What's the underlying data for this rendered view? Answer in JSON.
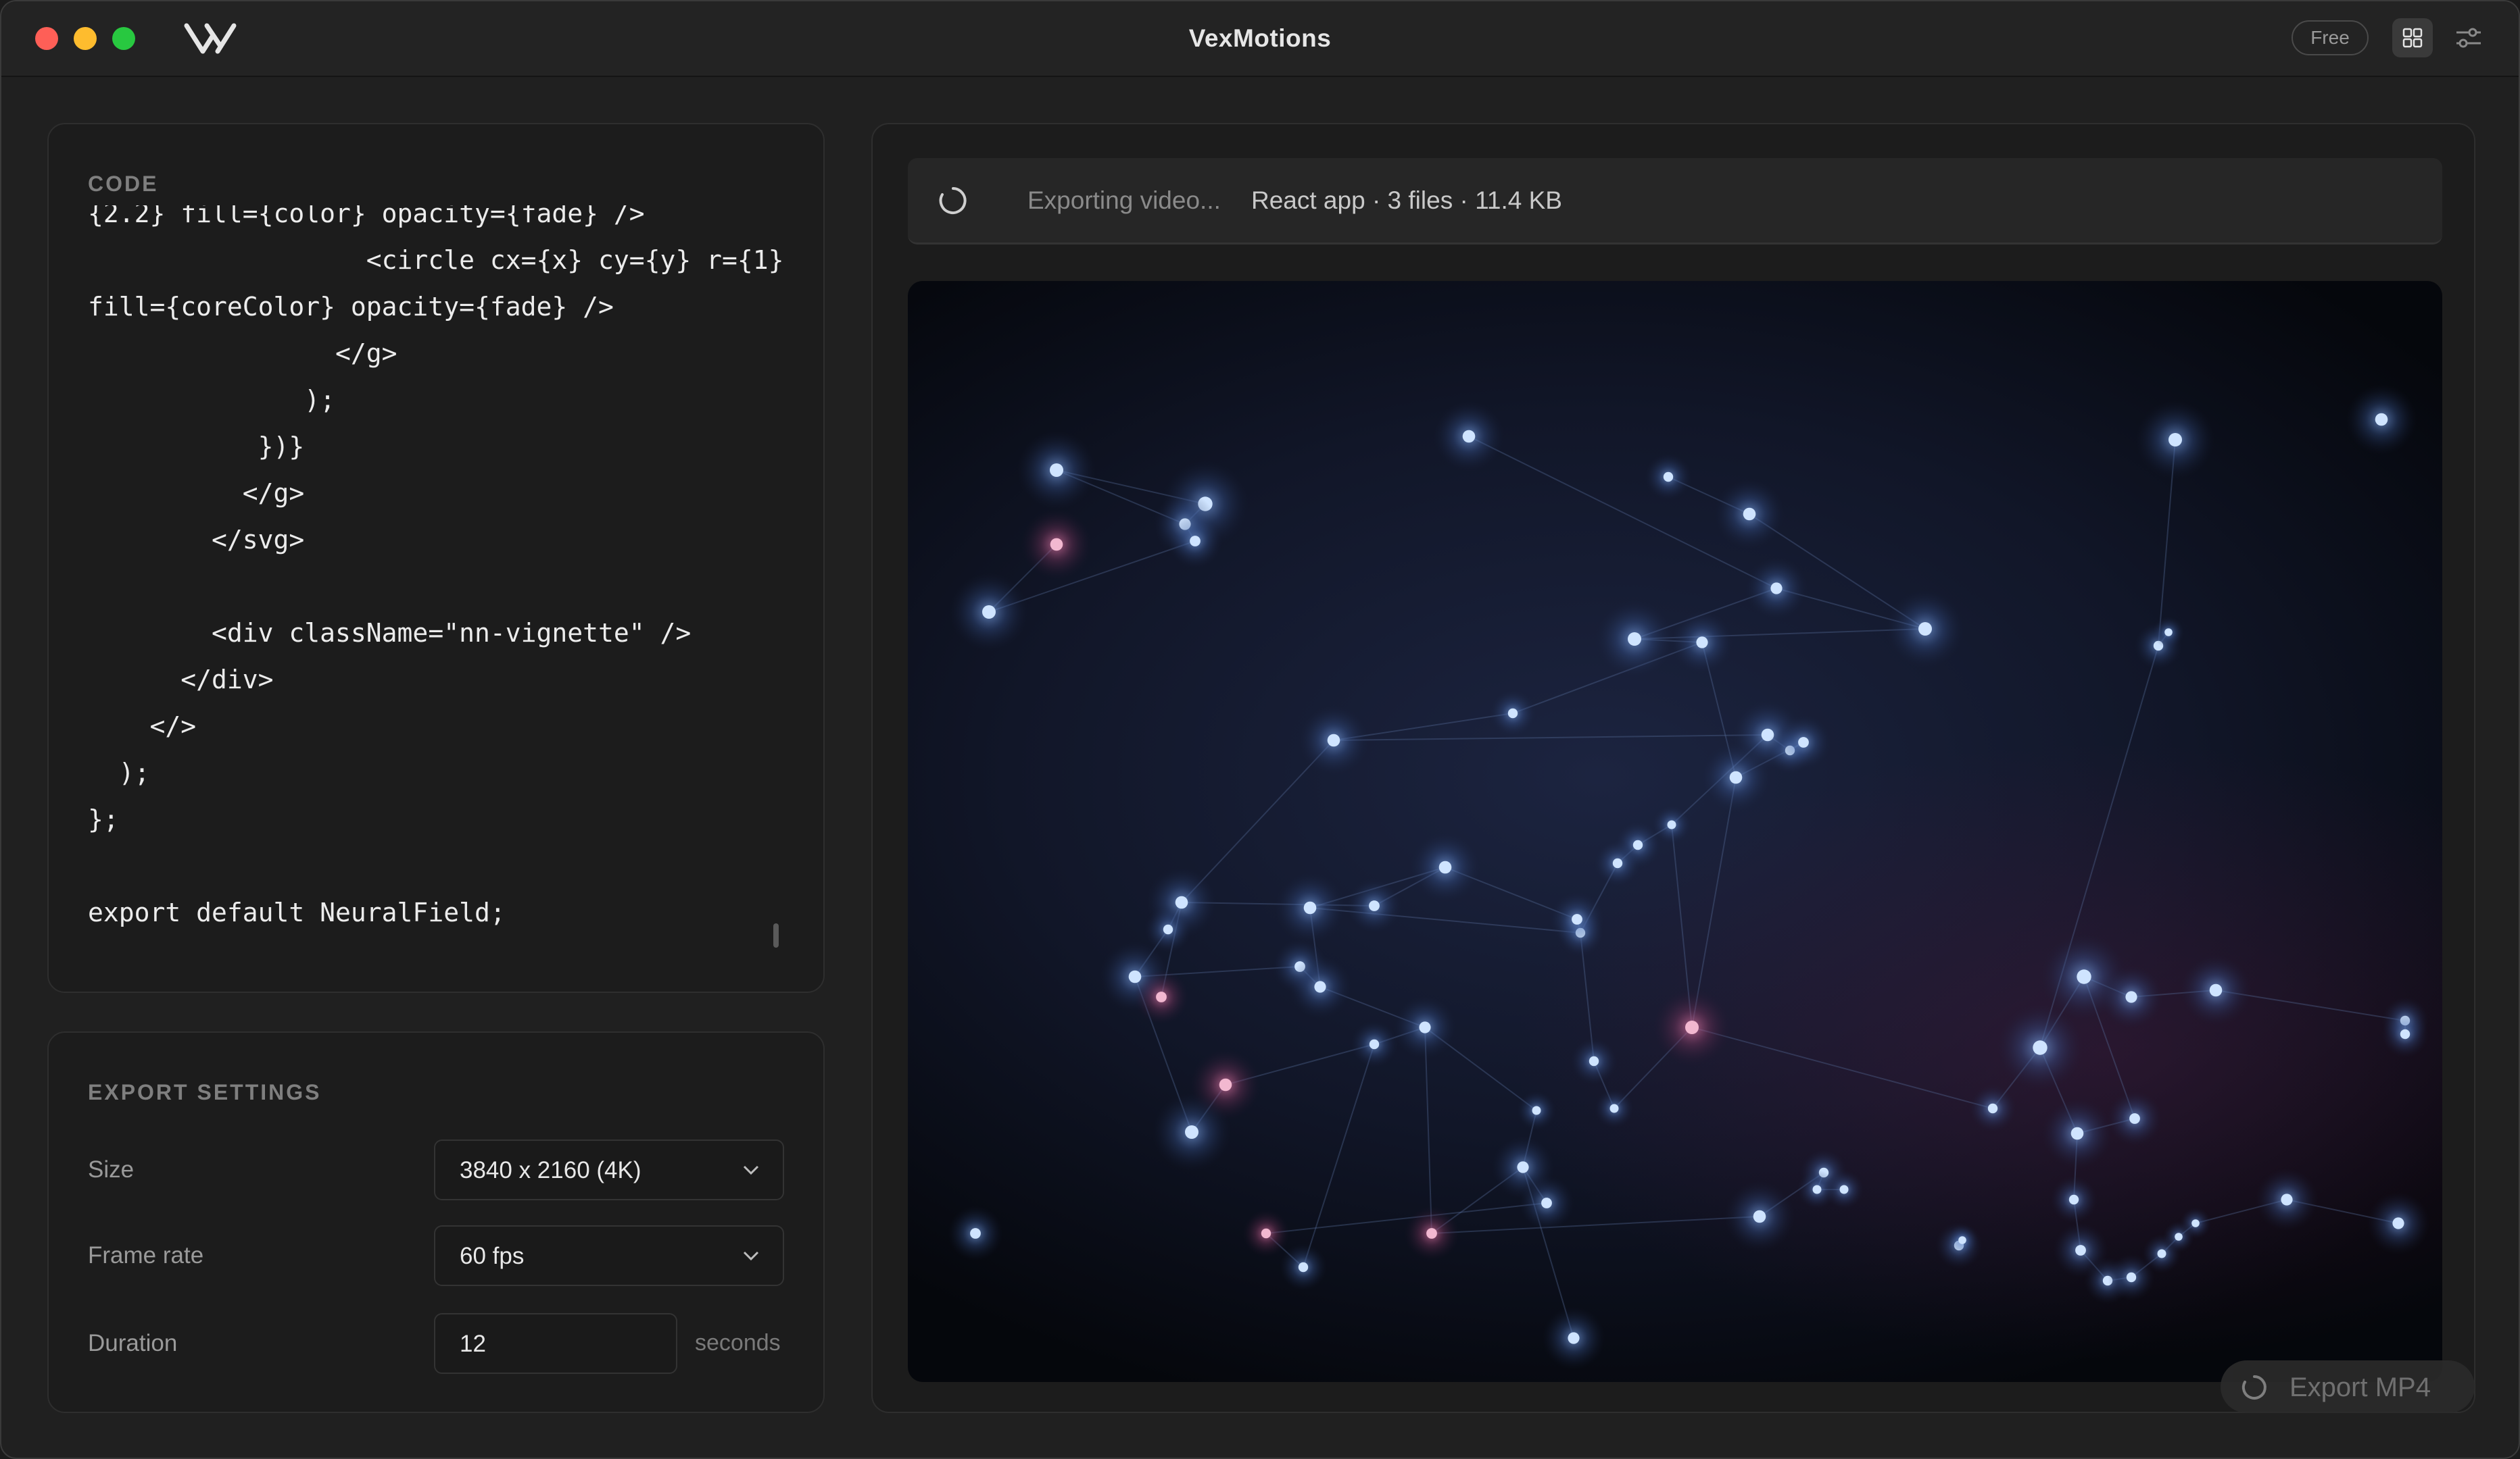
{
  "window": {
    "title": "VexMotions",
    "plan_badge": "Free"
  },
  "code_panel": {
    "label": "CODE",
    "lines": [
      "{2.2} fill={color} opacity={fade} />",
      "                  <circle cx={x} cy={y} r={1}",
      "fill={coreColor} opacity={fade} />",
      "                </g>",
      "              );",
      "           })}",
      "          </g>",
      "        </svg>",
      "",
      "        <div className=\"nn-vignette\" />",
      "      </div>",
      "    </>",
      "  );",
      "};",
      "",
      "export default NeuralField;"
    ]
  },
  "export_settings": {
    "label": "EXPORT SETTINGS",
    "size_label": "Size",
    "size_value": "3840 x 2160 (4K)",
    "frame_rate_label": "Frame rate",
    "frame_rate_value": "60 fps",
    "duration_label": "Duration",
    "duration_value": "12",
    "duration_unit": "seconds"
  },
  "preview": {
    "status_text": "Exporting video...",
    "status_meta": "React app · 3 files · 11.4 KB"
  },
  "export_button": {
    "label": "Export MP4"
  },
  "icons": {
    "logo": "vexmotions-logo-icon",
    "grid": "grid-icon",
    "settings": "sliders-icon",
    "spinner": "spinner-icon",
    "chevron": "chevron-down-icon"
  },
  "colors": {
    "accent_node_blue": "#cfe4ff",
    "accent_node_pink": "#f2b8d0",
    "traffic_red": "#fe5f57",
    "traffic_yellow": "#febc2e",
    "traffic_green": "#28c840"
  }
}
